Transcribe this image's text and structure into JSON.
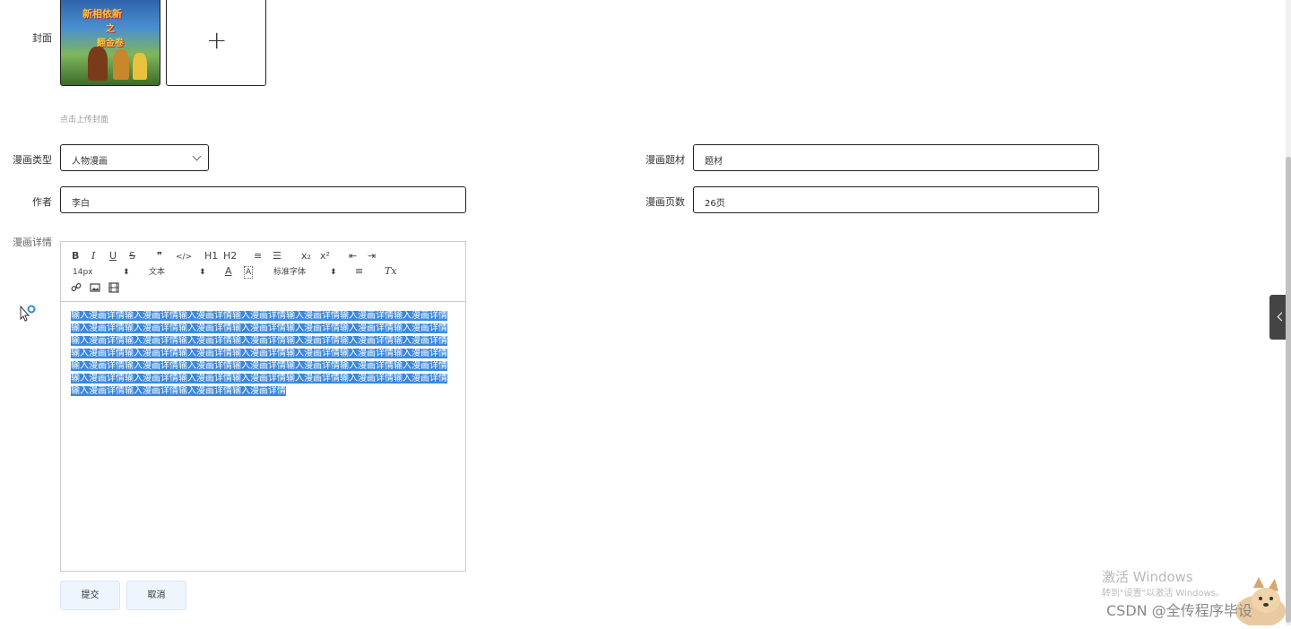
{
  "cover": {
    "label": "封面",
    "thumb_text": [
      "新相依新",
      "之",
      "翻金卷"
    ],
    "plus": "+",
    "hint": "点击上传封面"
  },
  "fields": {
    "type_label": "漫画类型",
    "type_value": "人物漫画",
    "theme_label": "漫画题材",
    "theme_value": "题材",
    "author_label": "作者",
    "author_value": "李白",
    "pages_label": "漫画页数",
    "pages_value": "26页",
    "detail_label": "漫画详情"
  },
  "editor": {
    "toolbar": {
      "bold": "B",
      "italic": "I",
      "underline": "U",
      "strike": "S",
      "blockquote": "❞",
      "code": "</>",
      "h1": "H1",
      "h2": "H2",
      "ordered_list": "≡",
      "bullet_list": "☰",
      "subscript": "x₂",
      "superscript": "x²",
      "outdent": "⇤",
      "indent": "⇥",
      "size": "14px",
      "header": "文本",
      "color": "A",
      "background": "A",
      "font": "标准字体",
      "align": "≡",
      "clean": "Tx"
    },
    "content": "输入漫画详情输入漫画详情输入漫画详情输入漫画详情输入漫画详情输入漫画详情输入漫画详情输入漫画详情输入漫画详情输入漫画详情输入漫画详情输入漫画详情输入漫画详情输入漫画详情输入漫画详情输入漫画详情输入漫画详情输入漫画详情输入漫画详情输入漫画详情输入漫画详情输入漫画详情输入漫画详情输入漫画详情输入漫画详情输入漫画详情输入漫画详情输入漫画详情输入漫画详情输入漫画详情输入漫画详情输入漫画详情输入漫画详情输入漫画详情输入漫画详情输入漫画详情输入漫画详情输入漫画详情输入漫画详情输入漫画详情输入漫画详情输入漫画详情输入漫画详情输入漫画详情输入漫画详情输入漫画详情"
  },
  "buttons": {
    "submit": "提交",
    "cancel": "取消"
  },
  "watermark": {
    "line1": "激活 Windows",
    "line2": "转到\"设置\"以激活 Windows。",
    "csdn": "CSDN @全传程序毕设"
  },
  "colors": {
    "selection": "#3a88e0",
    "button_bg": "#eef5fd",
    "border": "#222222"
  }
}
